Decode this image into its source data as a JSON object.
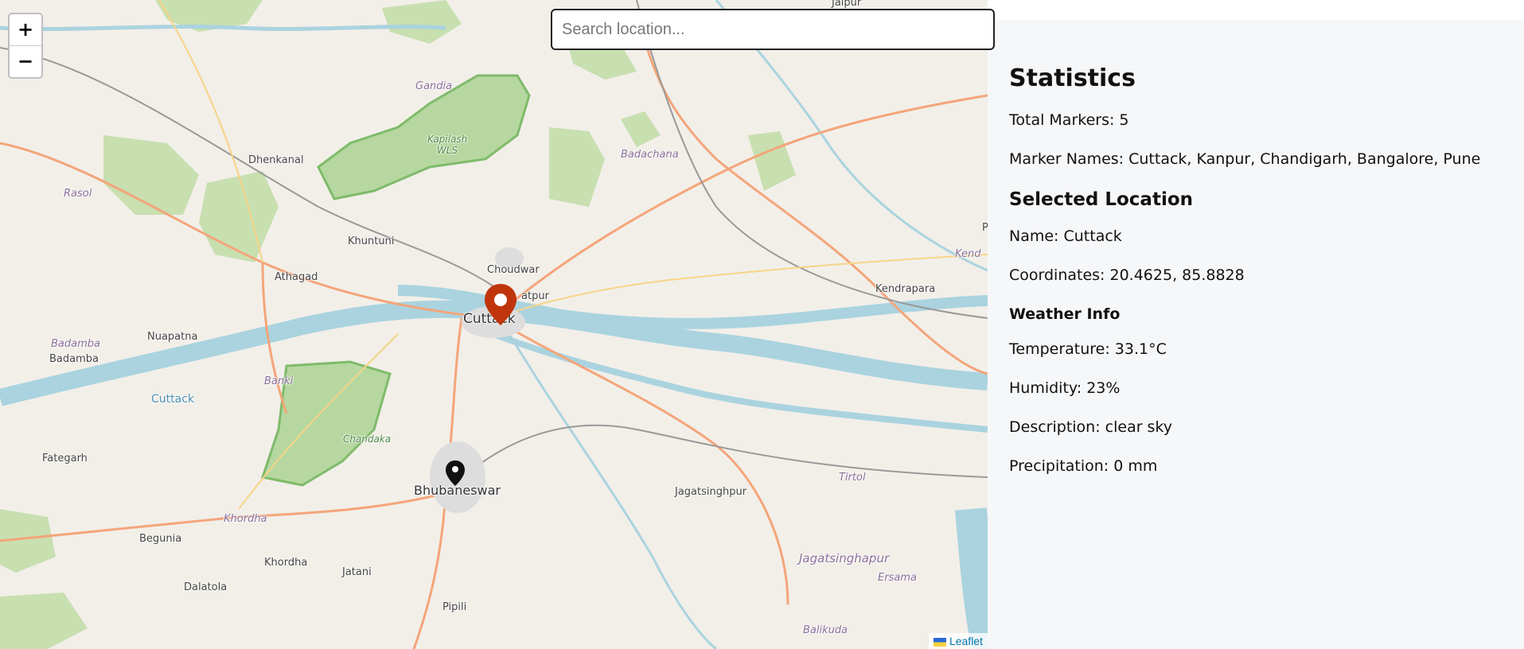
{
  "search": {
    "placeholder": "Search location..."
  },
  "map": {
    "zoom_in": "+",
    "zoom_out": "−",
    "attribution": "Leaflet",
    "places": [
      {
        "name": "Jaipur"
      },
      {
        "name": "Gandia"
      },
      {
        "name": "Kapilash WLS"
      },
      {
        "name": "Badachana"
      },
      {
        "name": "Dhenkanal"
      },
      {
        "name": "Rasol"
      },
      {
        "name": "Khuntuni"
      },
      {
        "name": "Choudwar"
      },
      {
        "name": "Athagad"
      },
      {
        "name": "atpur"
      },
      {
        "name": "Cuttack"
      },
      {
        "name": "Kend"
      },
      {
        "name": "Kendrapara"
      },
      {
        "name": "Nuapatna"
      },
      {
        "name": "Badamba"
      },
      {
        "name": "Badamba"
      },
      {
        "name": "Banki"
      },
      {
        "name": "Cuttack"
      },
      {
        "name": "Chandaka"
      },
      {
        "name": "Fategarh"
      },
      {
        "name": "Bhubaneswar"
      },
      {
        "name": "Tirtol"
      },
      {
        "name": "Jagatsinghpur"
      },
      {
        "name": "Khordha"
      },
      {
        "name": "Begunia"
      },
      {
        "name": "Khordha"
      },
      {
        "name": "Jatani"
      },
      {
        "name": "Dalatola"
      },
      {
        "name": "Jagatsinghapur"
      },
      {
        "name": "Ersama"
      },
      {
        "name": "Pipili"
      },
      {
        "name": "Balikuda"
      },
      {
        "name": "P"
      }
    ],
    "markers": [
      {
        "name": "selected-marker",
        "color": "#c0350c"
      },
      {
        "name": "marker",
        "color": "#111111"
      }
    ]
  },
  "stats": {
    "title": "Statistics",
    "total_markers": "Total Markers: 5",
    "marker_names": "Marker Names: Cuttack, Kanpur, Chandigarh, Bangalore, Pune"
  },
  "selected": {
    "title": "Selected Location",
    "name": "Name: Cuttack",
    "coordinates": "Coordinates: 20.4625, 85.8828"
  },
  "weather": {
    "title": "Weather Info",
    "temperature": "Temperature: 33.1°C",
    "humidity": "Humidity: 23%",
    "description": "Description: clear sky",
    "precipitation": "Precipitation: 0 mm"
  }
}
